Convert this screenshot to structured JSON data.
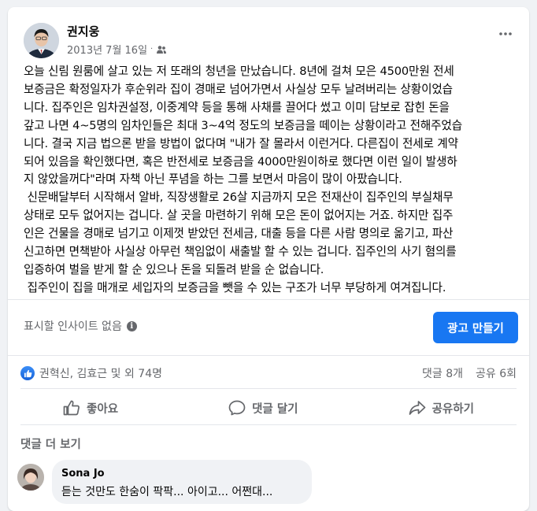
{
  "post": {
    "author": "권지웅",
    "date": "2013년 7월 16일",
    "date_separator": "·",
    "audience_icon": "friends-icon",
    "more_icon": "more-options-icon",
    "text": "오늘 신림 원룸에 살고 있는 저 또래의 청년을 만났습니다. 8년에 걸쳐 모은 4500만원 전세\n보증금은 확정일자가 후순위라 집이 경매로 넘어가면서 사실상 모두 날려버리는 상황이었습\n니다. 집주인은 임차권설정, 이중계약 등을 통해 사채를 끌어다 썼고 이미 담보로 잡힌 돈을\n갚고 나면 4~5명의 임차인들은 최대 3~4억 정도의 보증금을 떼이는 상황이라고 전해주었습\n니다. 결국 지금 법으론 받을 방법이 없다며 \"내가 잘 몰라서 이런거다. 다른집이 전세로 계약\n되어 있음을 확인했다면, 혹은 반전세로 보증금을 4000만원이하로 했다면 이런 일이 발생하\n지 않았을꺼다\"라며 자책 아닌 푸념을 하는 그를 보면서 마음이 많이 아팠습니다.\n 신문배달부터 시작해서 알바, 직장생활로 26살 지금까지 모은 전재산이 집주인의 부실채무\n상태로 모두 없어지는 겁니다. 살 곳을 마련하기 위해 모은 돈이 없어지는 거죠. 하지만 집주\n인은 건물을 경매로 넘기고 이제껏 받았던 전세금, 대출 등을 다른 사람 명의로 옮기고, 파산\n신고하면 면책받아 사실상 아무런 책임없이 새출발 할 수 있는 겁니다. 집주인의 사기 혐의를\n입증하여 벌을 받게 할 순 있으나 돈을 되돌려 받을 순 없습니다.\n 집주인이 집을 매개로 세입자의 보증금을 뺏을 수 있는 구조가 너무 부당하게 여겨집니다."
  },
  "insights": {
    "label": "표시할 인사이트 없음",
    "info_icon": "i",
    "ad_button": "광고 만들기"
  },
  "engagement": {
    "reactions_text": "권혁신, 김효근 및 외 74명",
    "comments_count": "댓글 8개",
    "shares_count": "공유 6회"
  },
  "actions": {
    "like": "좋아요",
    "comment": "댓글 달기",
    "share": "공유하기"
  },
  "comments": {
    "more_label": "댓글 더 보기",
    "items": [
      {
        "author": "Sona Jo",
        "text": "듣는 것만도 한숨이 팍팍... 아이고... 어쩐대..."
      }
    ]
  },
  "colors": {
    "primary": "#1877f2",
    "secondary_text": "#65676b",
    "background": "#f0f2f5"
  }
}
